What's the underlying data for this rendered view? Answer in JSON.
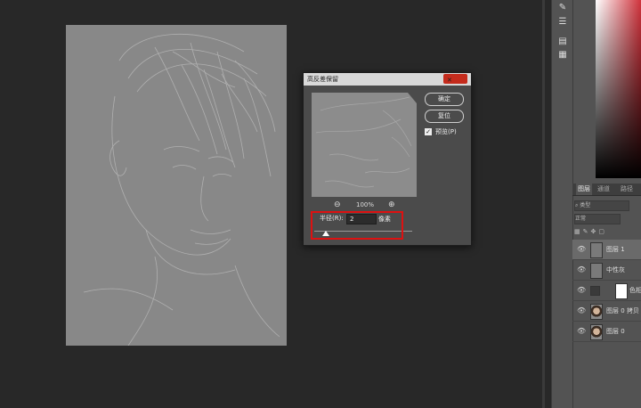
{
  "dialog": {
    "title": "高反差保留",
    "close_glyph": "✕",
    "ok_label": "确定",
    "reset_label": "复位",
    "preview_label": "预览(P)",
    "preview_checked": true,
    "zoom_out_glyph": "⊖",
    "zoom_in_glyph": "⊕",
    "zoom_value": "100%",
    "radius_label": "半径(R):",
    "radius_value": "2",
    "radius_unit": "像素"
  },
  "layers_panel": {
    "tabs": [
      "图层",
      "通道",
      "路径"
    ],
    "search_placeholder": "类型",
    "blend_mode": "正常",
    "layers": [
      {
        "name": "图层 1",
        "selected": true,
        "thumb": "neutral"
      },
      {
        "name": "中性灰",
        "selected": false,
        "thumb": "neutral"
      },
      {
        "name": "色相",
        "selected": false,
        "thumb": "adjustment"
      },
      {
        "name": "图层 0 拷贝",
        "selected": false,
        "thumb": "face"
      },
      {
        "name": "图层 0",
        "selected": false,
        "thumb": "face"
      }
    ]
  },
  "icons": {
    "eye": "👁",
    "brush": "✎",
    "sliders": "☰",
    "panel": "▤",
    "note": "▦",
    "search": "⌕"
  },
  "colors": {
    "highlight_border": "#dd1111",
    "close_button": "#c42b1c",
    "picker_hue": "#d0333c"
  }
}
